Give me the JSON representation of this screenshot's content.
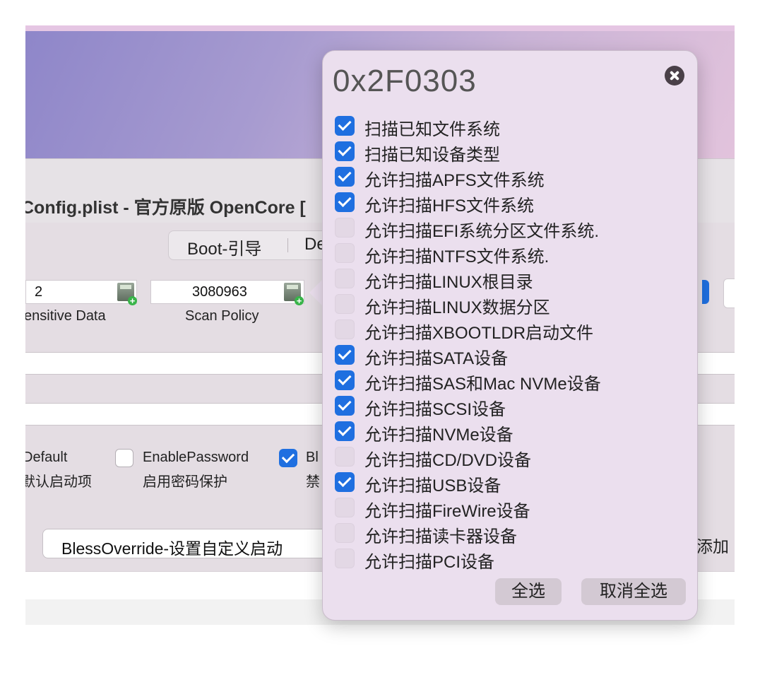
{
  "window": {
    "title": "Config.plist - 官方原版 OpenCore [",
    "tabs": [
      "Boot-引导",
      "De"
    ]
  },
  "fields": {
    "sensitive": {
      "value": "2",
      "label": "ensitive Data"
    },
    "scan_policy": {
      "value": "3080963",
      "label": "Scan Policy"
    }
  },
  "checkboxes": {
    "default": {
      "label": "Default",
      "cn": "默认启动项"
    },
    "enable_password": {
      "label": "EnablePassword",
      "cn": "启用密码保护",
      "checked": false
    },
    "bl": {
      "label": "Bl",
      "cn": "禁",
      "checked": true
    }
  },
  "bless": {
    "text": "BlessOverride-设置自定义启动",
    "add": "添加"
  },
  "popover": {
    "title": "0x2F0303",
    "options": [
      {
        "label": "扫描已知文件系统",
        "checked": true
      },
      {
        "label": "扫描已知设备类型",
        "checked": true
      },
      {
        "label": "允许扫描APFS文件系统",
        "checked": true
      },
      {
        "label": "允许扫描HFS文件系统",
        "checked": true
      },
      {
        "label": "允许扫描EFI系统分区文件系统.",
        "checked": false
      },
      {
        "label": "允许扫描NTFS文件系统.",
        "checked": false
      },
      {
        "label": "允许扫描LINUX根目录",
        "checked": false
      },
      {
        "label": "允许扫描LINUX数据分区",
        "checked": false
      },
      {
        "label": "允许扫描XBOOTLDR启动文件",
        "checked": false
      },
      {
        "label": "允许扫描SATA设备",
        "checked": true
      },
      {
        "label": "允许扫描SAS和Mac NVMe设备",
        "checked": true
      },
      {
        "label": "允许扫描SCSI设备",
        "checked": true
      },
      {
        "label": "允许扫描NVMe设备",
        "checked": true
      },
      {
        "label": " 允许扫描CD/DVD设备",
        "checked": false
      },
      {
        "label": "允许扫描USB设备",
        "checked": true
      },
      {
        "label": "允许扫描FireWire设备",
        "checked": false
      },
      {
        "label": "允许扫描读卡器设备",
        "checked": false
      },
      {
        "label": "允许扫描PCI设备",
        "checked": false
      }
    ],
    "select_all": "全选",
    "deselect_all": "取消全选"
  },
  "colors": {
    "accent": "#1f6fe0",
    "popover_bg": "#ebdfee"
  }
}
